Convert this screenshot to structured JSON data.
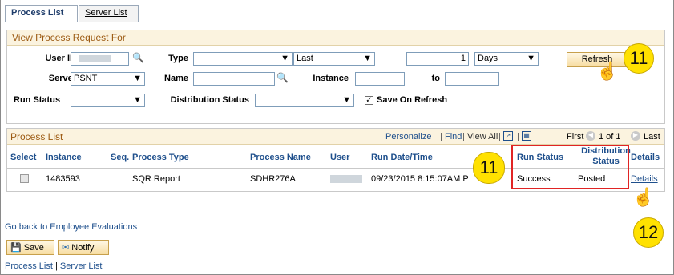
{
  "tabs": [
    "Process List",
    "Server List"
  ],
  "filter": {
    "header": "View Process Request For",
    "user_id_label": "User ID",
    "type_label": "Type",
    "type_value": "",
    "last_value": "Last",
    "count_value": "1",
    "days_value": "Days",
    "refresh_label": "Refresh",
    "server_label": "Server",
    "server_value": "PSNT",
    "name_label": "Name",
    "instance_label": "Instance",
    "to_label": "to",
    "run_status_label": "Run Status",
    "dist_status_label": "Distribution Status",
    "save_on_refresh_label": "Save On Refresh",
    "save_on_refresh_checked": "✓"
  },
  "grid": {
    "title": "Process List",
    "personalize": "Personalize",
    "find": "Find",
    "view_all": "View All",
    "first": "First",
    "range": "1 of 1",
    "last": "Last",
    "columns": {
      "select": "Select",
      "instance": "Instance",
      "seq": "Seq.",
      "process_type": "Process Type",
      "process_name": "Process Name",
      "user": "User",
      "run_datetime": "Run Date/Time",
      "run_status": "Run Status",
      "dist_status_1": "Distribution",
      "dist_status_2": "Status",
      "details": "Details"
    },
    "row": {
      "instance": "1483593",
      "seq": "",
      "process_type": "SQR Report",
      "process_name": "SDHR276A",
      "run_datetime": "09/23/2015 8:15:07AM P",
      "run_status": "Success",
      "dist_status": "Posted",
      "details": "Details"
    }
  },
  "links": {
    "go_back": "Go back to Employee Evaluations",
    "save": "Save",
    "notify": "Notify",
    "bottom_process_list": "Process List",
    "bottom_sep": "|",
    "bottom_server_list": "Server List"
  },
  "callouts": {
    "refresh": "11",
    "run_status": "11",
    "details": "12"
  },
  "colors": {
    "accent": "#1e4f8c",
    "header_bg": "#fbf3df",
    "callout": "#ffe100",
    "highlight": "#e02424"
  }
}
